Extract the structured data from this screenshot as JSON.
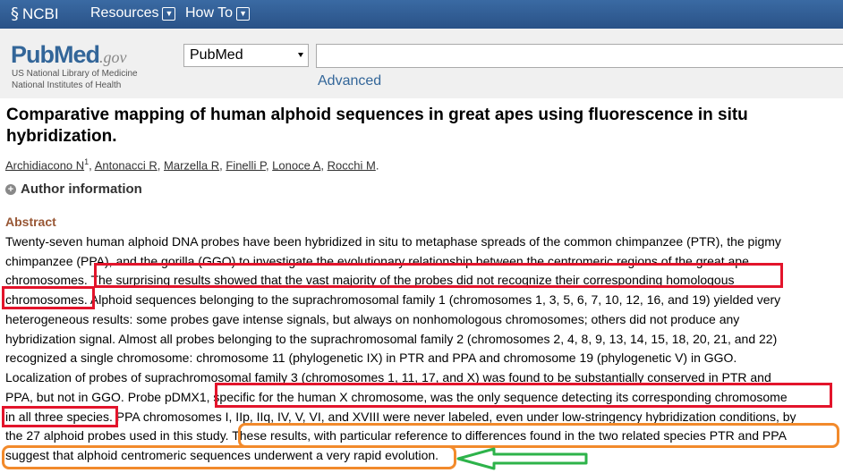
{
  "ncbi": {
    "logo_text": "NCBI",
    "menu": [
      {
        "label": "Resources"
      },
      {
        "label": "How To"
      }
    ]
  },
  "pubmed": {
    "logo_main": "PubMed",
    "logo_suffix": ".gov",
    "subtitle_1": "US National Library of Medicine",
    "subtitle_2": "National Institutes of Health"
  },
  "search": {
    "database": "PubMed",
    "query": "",
    "advanced_label": "Advanced"
  },
  "article": {
    "title_line1": "Comparative mapping of human alphoid sequences in great apes using fluorescence in situ",
    "title_line2": "hybridization.",
    "authors": [
      {
        "name": "Archidiacono N",
        "sup": "1"
      },
      {
        "name": "Antonacci R"
      },
      {
        "name": "Marzella R"
      },
      {
        "name": "Finelli P"
      },
      {
        "name": "Lonoce A"
      },
      {
        "name": "Rocchi M"
      }
    ],
    "author_info_label": "Author information",
    "abstract_heading": "Abstract",
    "abstract_lines": [
      "Twenty-seven human alphoid DNA probes have been hybridized in situ to metaphase spreads of the common chimpanzee (PTR), the pigmy",
      "chimpanzee (PPA), and the gorilla (GGO) to investigate the evolutionary relationship between the centromeric regions of the great ape",
      "chromosomes. The surprising results showed that the vast majority of the probes did not recognize their corresponding homologous",
      "chromosomes. Alphoid sequences belonging to the suprachromosomal family 1 (chromosomes 1, 3, 5, 6, 7, 10, 12, 16, and 19) yielded very",
      "heterogeneous results: some probes gave intense signals, but always on nonhomologous chromosomes; others did not produce any",
      "hybridization signal. Almost all probes belonging to the suprachromosomal family 2 (chromosomes 2, 4, 8, 9, 13, 14, 15, 18, 20, 21, and 22)",
      "recognized a single chromosome: chromosome 11 (phylogenetic IX) in PTR and PPA and chromosome 19 (phylogenetic V) in GGO.",
      "Localization of probes of suprachromosomal family 3 (chromosomes 1, 11, 17, and X) was found to be substantially conserved in PTR and",
      "PPA, but not in GGO. Probe pDMX1, specific for the human X chromosome, was the only sequence detecting its corresponding chromosome",
      "in all three species. PPA chromosomes I, IIp, IIq, IV, V, VI, and XVIII were never labeled, even under low-stringency hybridization conditions, by",
      "the 27 alphoid probes used in this study. These results, with particular reference to differences found in the two related species PTR and PPA",
      "suggest that alphoid centromeric sequences underwent a very rapid evolution."
    ]
  },
  "colors": {
    "highlight_red": "#e3142b",
    "highlight_orange": "#f28a2b",
    "arrow_green": "#2db34a",
    "abstract_heading": "#985735"
  }
}
